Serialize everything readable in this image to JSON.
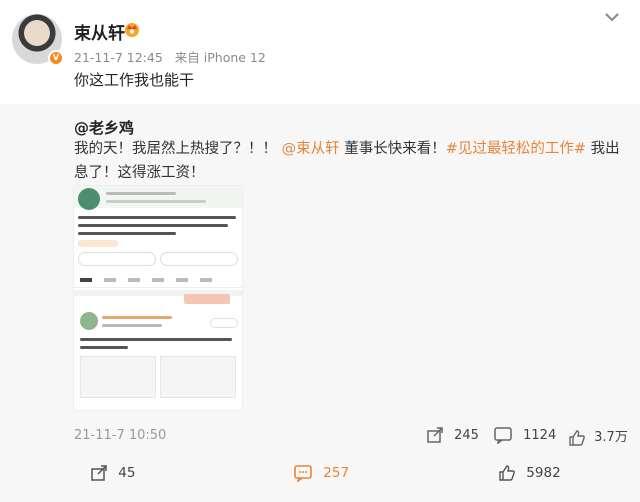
{
  "post": {
    "author": "束从轩",
    "meta": {
      "date": "21-11-7 12:45",
      "source": "来自 iPhone 12"
    },
    "text": "你这工作我也能干"
  },
  "repost": {
    "user": "@老乡鸡",
    "text_a": "我的天！我居然上热搜了？！！",
    "mention": "@束从轩",
    "text_b": " 董事长快来看！",
    "topic": "#见过最轻松的工作#",
    "text_c": " 我出息了！这得涨工资！",
    "time": "21-11-7 10:50",
    "actions": {
      "share": "245",
      "comment": "1124",
      "like": "3.7万"
    }
  },
  "bottom_bar": {
    "share": "45",
    "comment": "257",
    "like": "5982"
  },
  "colors": {
    "accent": "#e8843a",
    "muted": "#999999",
    "repost_bg": "#f7f7f7"
  }
}
